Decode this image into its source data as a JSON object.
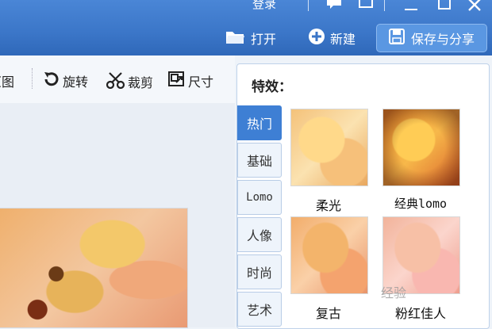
{
  "title_bar": {
    "login": "登录"
  },
  "top_actions": {
    "open": "打开",
    "new": "新建",
    "save_share": "保存与分享"
  },
  "toolbar": {
    "partial_left": "原图",
    "rotate": "旋转",
    "crop": "裁剪",
    "size": "尺寸"
  },
  "effects": {
    "title": "特效：",
    "tabs": [
      {
        "label": "热门",
        "active": true
      },
      {
        "label": "基础"
      },
      {
        "label": "Lomo"
      },
      {
        "label": "人像"
      },
      {
        "label": "时尚"
      },
      {
        "label": "艺术"
      }
    ],
    "items": [
      {
        "label": "柔光"
      },
      {
        "label": "经典lomo"
      },
      {
        "label": "复古"
      },
      {
        "label": "粉红佳人"
      }
    ]
  },
  "watermark": "经验"
}
